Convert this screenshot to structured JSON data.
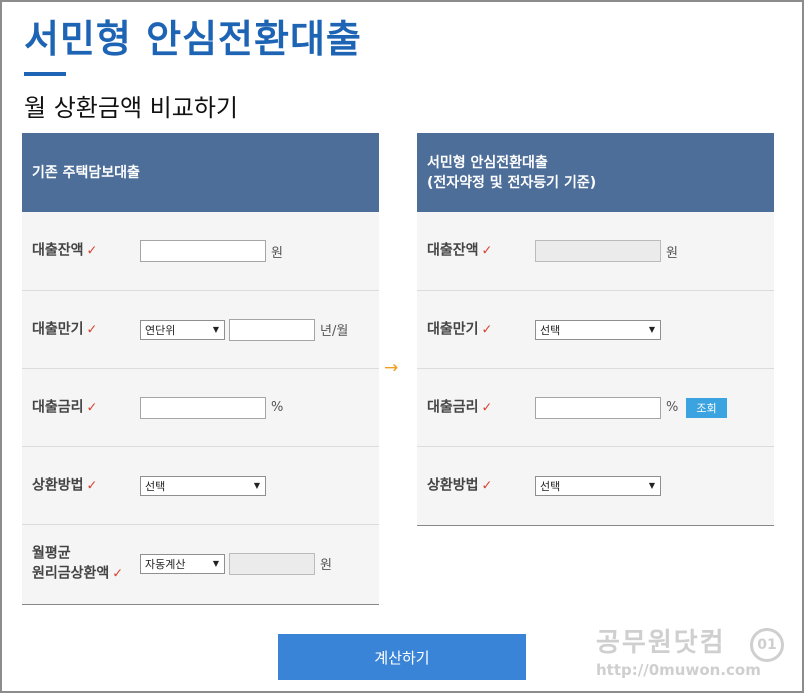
{
  "page": {
    "title": "서민형 안심전환대출",
    "subtitle": "월 상환금액 비교하기"
  },
  "left_panel": {
    "header": "기존 주택담보대출",
    "rows": [
      {
        "label": "대출잔액",
        "unit": "원"
      },
      {
        "label": "대출만기",
        "select": "연단위",
        "unit": "년/월"
      },
      {
        "label": "대출금리",
        "unit": "%"
      },
      {
        "label": "상환방법",
        "select": "선택"
      },
      {
        "label_line1": "월평균",
        "label_line2": "원리금상환액",
        "select": "자동계산",
        "unit": "원"
      }
    ]
  },
  "right_panel": {
    "header_line1": "서민형 안심전환대출",
    "header_line2": "(전자약정 및 전자등기 기준)",
    "rows": [
      {
        "label": "대출잔액",
        "unit": "원"
      },
      {
        "label": "대출만기",
        "select": "선택"
      },
      {
        "label": "대출금리",
        "unit": "%",
        "button": "조회"
      },
      {
        "label": "상환방법",
        "select": "선택"
      }
    ]
  },
  "check_mark": "✓",
  "flow_arrow": "→",
  "dropdown_arrow": "▼",
  "calc_button": "계산하기",
  "watermark": {
    "name": "공무원닷컴",
    "url": "http://0muwon.com",
    "logo": "01"
  },
  "colors": {
    "title": "#1e64b4",
    "header_bg": "#4d6e99",
    "check": "#d9422f",
    "calc_button": "#3a84d8",
    "lookup_button": "#3aa3e0",
    "flow_arrow": "#f0a020"
  }
}
